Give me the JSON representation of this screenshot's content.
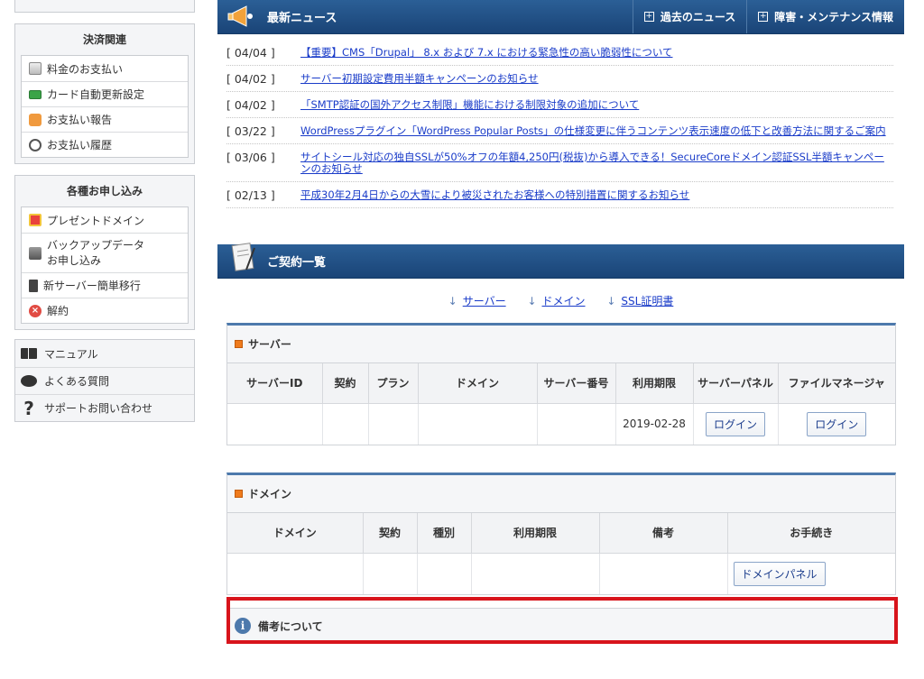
{
  "sidebar": {
    "payment": {
      "title": "決済関連",
      "items": [
        {
          "label": "料金のお支払い",
          "icon": "invoice-icon"
        },
        {
          "label": "カード自動更新設定",
          "icon": "credit-card-icon"
        },
        {
          "label": "お支払い報告",
          "icon": "report-icon"
        },
        {
          "label": "お支払い履歴",
          "icon": "clock-icon"
        }
      ]
    },
    "applications": {
      "title": "各種お申し込み",
      "items": [
        {
          "label": "プレゼントドメイン",
          "icon": "gift-icon"
        },
        {
          "label1": "バックアップデータ",
          "label2": "お申し込み",
          "icon": "backup-icon"
        },
        {
          "label": "新サーバー簡単移行",
          "icon": "server-icon"
        },
        {
          "label": "解約",
          "icon": "cancel-icon"
        }
      ]
    },
    "links": [
      {
        "label": "マニュアル",
        "icon": "book-icon"
      },
      {
        "label": "よくある質問",
        "icon": "speech-bubble-icon"
      },
      {
        "label": "サポートお問い合わせ",
        "icon": "question-mark-icon"
      }
    ]
  },
  "news": {
    "title": "最新ニュース",
    "past_link": "過去のニュース",
    "maintenance_link": "障害・メンテナンス情報",
    "items": [
      {
        "date": "[ 04/04 ]",
        "title": "【重要】CMS「Drupal」 8.x および 7.x における緊急性の高い脆弱性について"
      },
      {
        "date": "[ 04/02 ]",
        "title": "サーバー初期設定費用半額キャンペーンのお知らせ"
      },
      {
        "date": "[ 04/02 ]",
        "title": "「SMTP認証の国外アクセス制限」機能における制限対象の追加について"
      },
      {
        "date": "[ 03/22 ]",
        "title": "WordPressプラグイン「WordPress Popular Posts」の仕様変更に伴うコンテンツ表示速度の低下と改善方法に関するご案内"
      },
      {
        "date": "[ 03/06 ]",
        "title": "サイトシール対応の独自SSLが50%オフの年額4,250円(税抜)から導入できる！SecureCoreドメイン認証SSL半額キャンペーンのお知らせ"
      },
      {
        "date": "[ 02/13 ]",
        "title": "平成30年2月4日からの大雪により被災されたお客様への特別措置に関するお知らせ"
      }
    ]
  },
  "contracts": {
    "title": "ご契約一覧",
    "anchors": [
      "サーバー",
      "ドメイン",
      "SSL証明書"
    ],
    "anchor_arrow": "↓",
    "server": {
      "title": "サーバー",
      "columns": [
        "サーバーID",
        "契約",
        "プラン",
        "ドメイン",
        "サーバー番号",
        "利用期限",
        "サーバーパネル",
        "ファイルマネージャ"
      ],
      "row": {
        "expiry": "2019-02-28",
        "server_panel_button": "ログイン",
        "file_manager_button": "ログイン"
      }
    },
    "domain": {
      "title": "ドメイン",
      "columns": [
        "ドメイン",
        "契約",
        "種別",
        "利用期限",
        "備考",
        "お手続き"
      ],
      "row": {
        "panel_button": "ドメインパネル"
      }
    },
    "notes_title": "備考について",
    "notes_icon_glyph": "i"
  },
  "colors": {
    "accent_blue": "#1a4477",
    "link": "#1a3cc9",
    "highlight_red": "#d8141c",
    "section_marker": "#ef7b1d"
  }
}
